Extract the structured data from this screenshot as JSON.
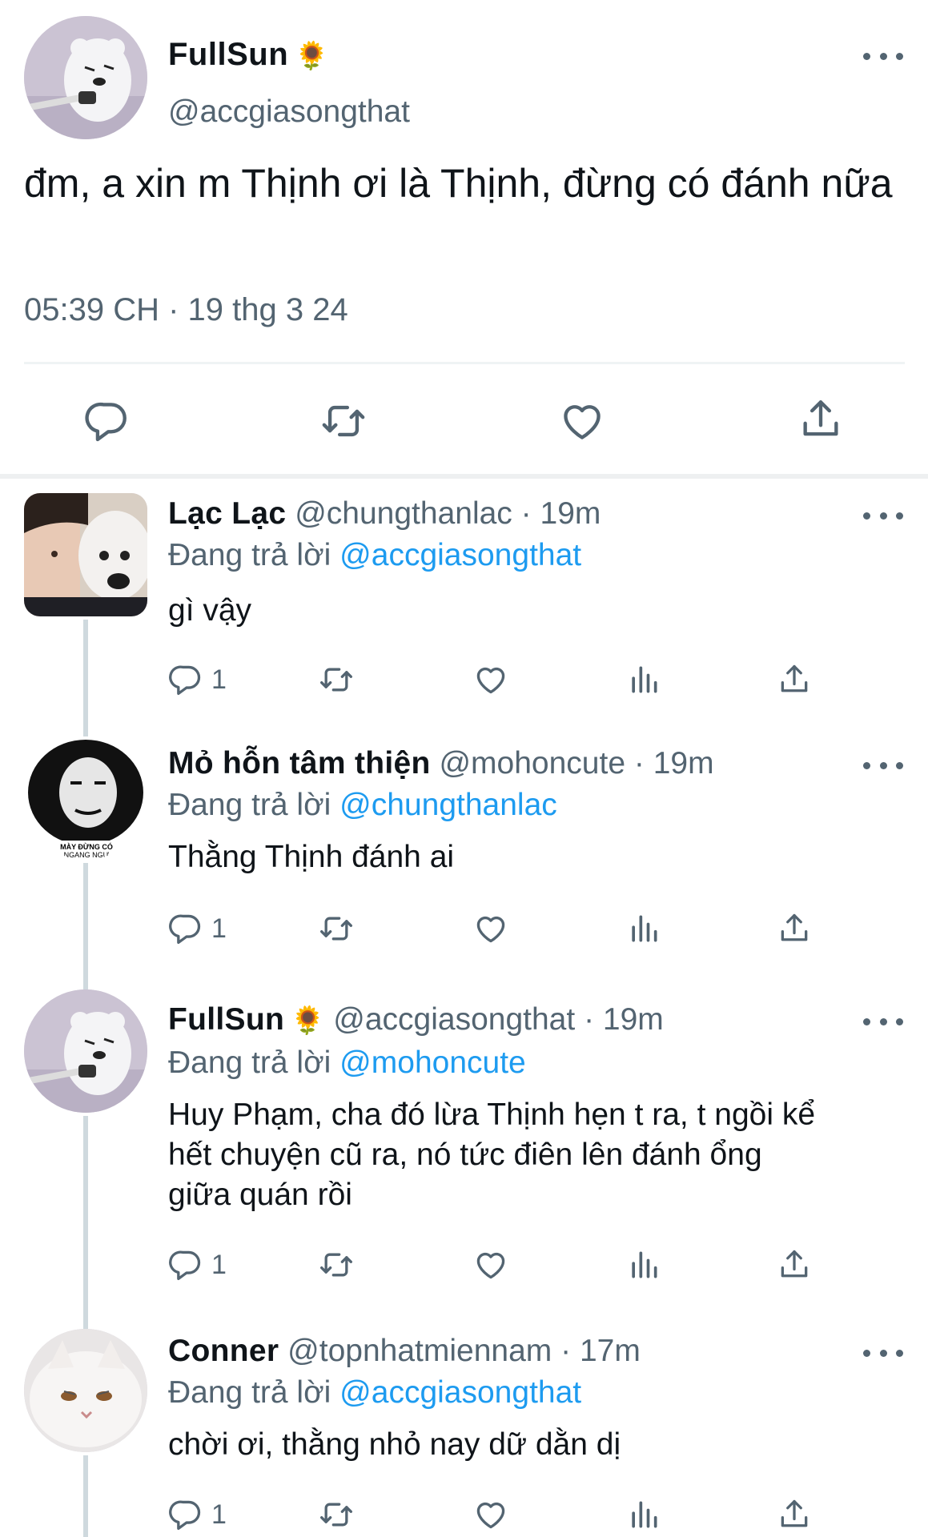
{
  "main_tweet": {
    "display_name": "FullSun",
    "emoji": "🌻",
    "handle": "@accgiasongthat",
    "text": "đm, a xin m Thịnh ơi là Thịnh, đừng có đánh nữa",
    "timestamp": "05:39 CH · 19 thg 3 24",
    "actions": [
      "reply-icon",
      "retweet-icon",
      "like-icon",
      "share-icon"
    ]
  },
  "replies": [
    {
      "display_name": "Lạc Lạc",
      "handle": "@chungthanlac",
      "time": "19m",
      "replying_label": "Đang trả lời",
      "replying_to": "@accgiasongthat",
      "text": "gì vậy",
      "reply_count": "1"
    },
    {
      "display_name": "Mỏ hỗn tâm thiện",
      "handle": "@mohoncute",
      "time": "19m",
      "replying_label": "Đang trả lời",
      "replying_to": "@chungthanlac",
      "text": "Thằng Thịnh đánh ai",
      "reply_count": "1",
      "avatar_caption": "MÀY ĐỪNG CÓ NGANG NGƯ"
    },
    {
      "display_name": "FullSun",
      "emoji": "🌻",
      "handle": "@accgiasongthat",
      "time": "19m",
      "replying_label": "Đang trả lời",
      "replying_to": "@mohoncute",
      "text_lines": [
        "Huy Phạm, cha đó lừa Thịnh hẹn t ra, t ngồi kể",
        "hết chuyện cũ ra, nó tức điên lên đánh ổng",
        "giữa quán rồi"
      ],
      "reply_count": "1"
    },
    {
      "display_name": "Conner",
      "handle": "@topnhatmiennam",
      "time": "17m",
      "replying_label": "Đang trả lời",
      "replying_to": "@accgiasongthat",
      "text": "chời ơi, thằng nhỏ nay dữ dằn dị",
      "reply_count": "1"
    }
  ],
  "colors": {
    "link": "#1d9bf0",
    "muted": "#536471",
    "text": "#0f1419",
    "divider": "#eff3f4"
  }
}
